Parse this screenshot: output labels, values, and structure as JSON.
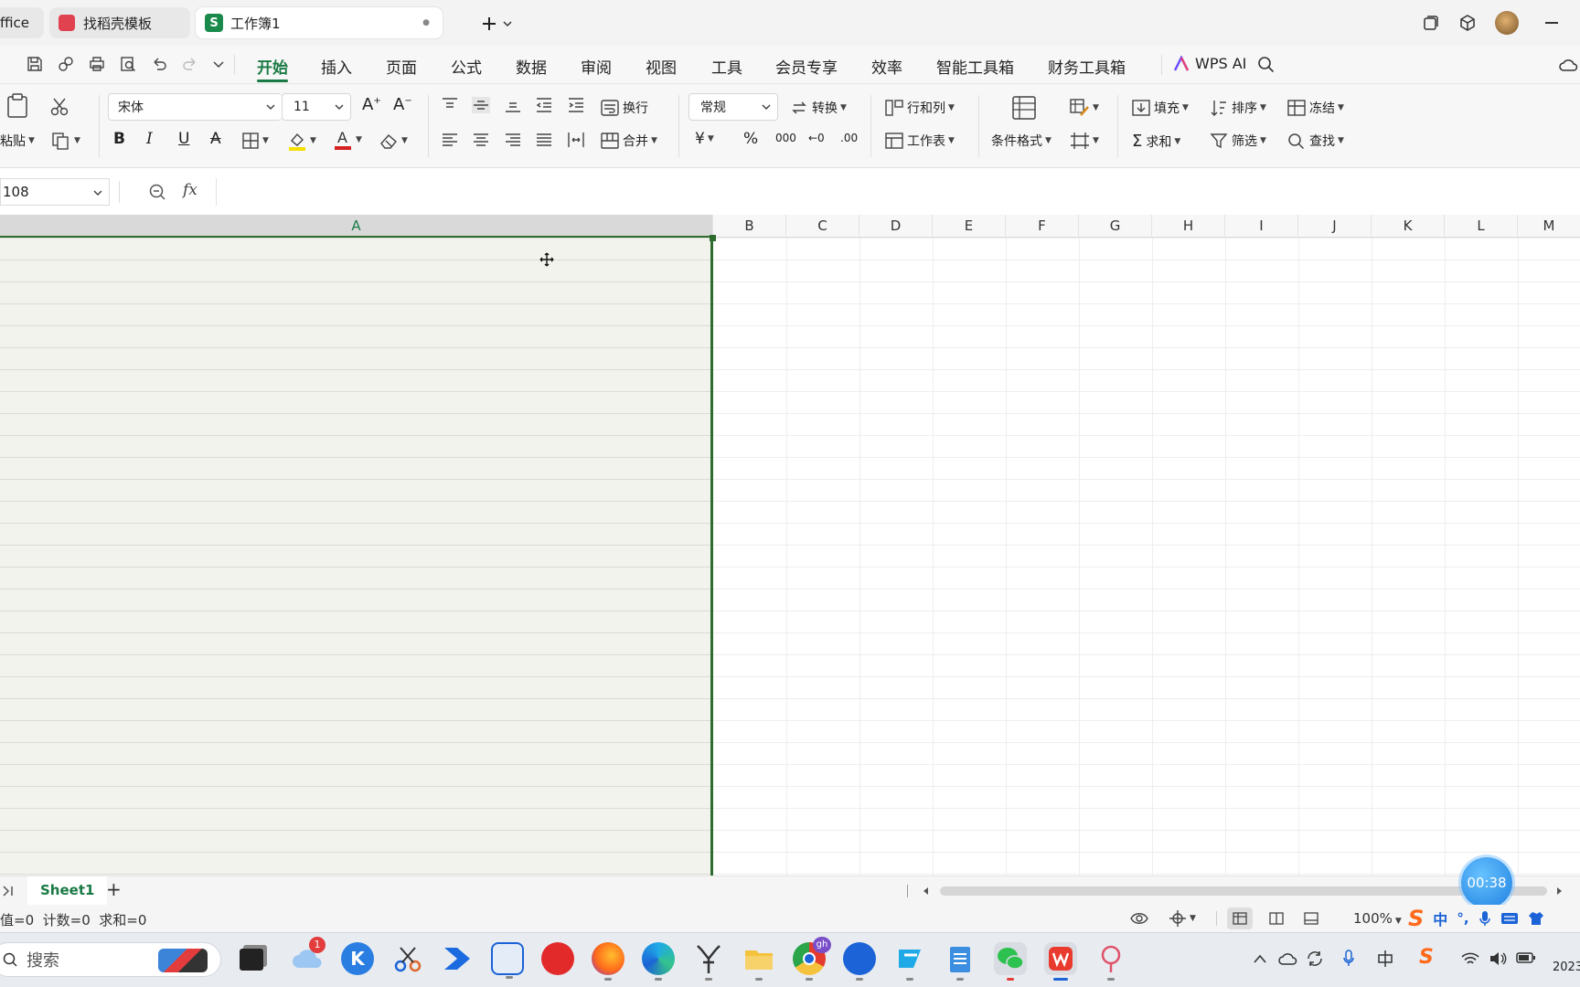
{
  "tabs": [
    {
      "label": "ffice"
    },
    {
      "label": "找稻壳模板"
    },
    {
      "label": "工作簿1",
      "badge": "S",
      "modified": "●"
    }
  ],
  "menu": {
    "items": [
      "开始",
      "插入",
      "页面",
      "公式",
      "数据",
      "审阅",
      "视图",
      "工具",
      "会员专享",
      "效率",
      "智能工具箱",
      "财务工具箱"
    ],
    "active": "开始",
    "ai_label": "WPS AI"
  },
  "ribbon": {
    "paste": "粘贴",
    "font_name": "宋体",
    "font_size": "11",
    "wrap": "换行",
    "merge": "合并",
    "number_format": "常规",
    "convert": "转换",
    "rowcol": "行和列",
    "worksheet": "工作表",
    "cond_format": "条件格式",
    "fill": "填充",
    "sort": "排序",
    "freeze": "冻结",
    "sum": "求和",
    "filter": "筛选",
    "find": "查找",
    "bold": "B",
    "italic": "I",
    "underline": "U",
    "currency": "¥",
    "percent": "%",
    "thousands": "000",
    "dec_inc": "←0",
    "dec_dec": ".00"
  },
  "formula_bar": {
    "cell_ref": "108",
    "fx": "fx",
    "value": ""
  },
  "columns": [
    "A",
    "B",
    "C",
    "D",
    "E",
    "F",
    "G",
    "H",
    "I",
    "J",
    "K",
    "L",
    "M"
  ],
  "sheets": {
    "active": "Sheet1",
    "add": "+"
  },
  "status": {
    "text": "值=0  计数=0  求和=0",
    "zoom": "100%"
  },
  "timer": "00:38",
  "taskbar": {
    "search_placeholder": "搜索",
    "notif_badge": "1",
    "chrome_badge": "gh",
    "year": "2023",
    "ime": "中"
  },
  "colors": {
    "accent": "#1a7a45",
    "selection_border": "#2e6b2e",
    "active_tab": "#ffffff"
  }
}
